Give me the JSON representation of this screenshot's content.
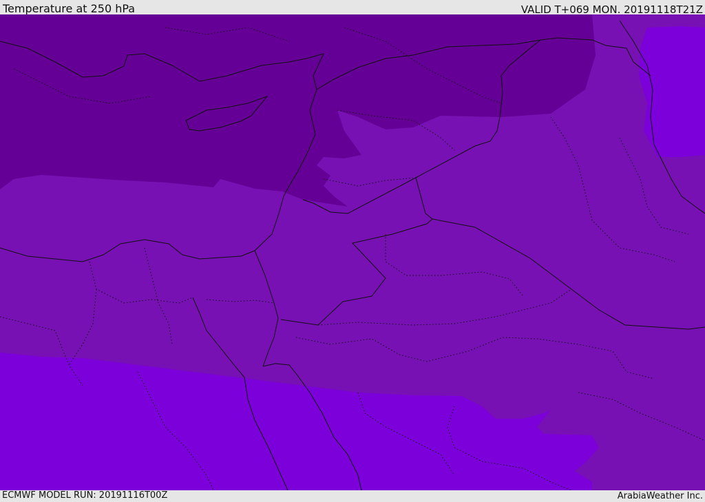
{
  "header": {
    "title": "Temperature at 250 hPa",
    "valid": "VALID T+069 MON. 20191118T21Z"
  },
  "footer": {
    "model_run": "ECMWF MODEL RUN: 20191116T00Z",
    "credit": "ArabiaWeather Inc."
  },
  "map": {
    "colors": {
      "band_cold": "#650096",
      "band_mid": "#7711b3",
      "band_warm": "#7c00d9",
      "outline": "#111111"
    }
  }
}
